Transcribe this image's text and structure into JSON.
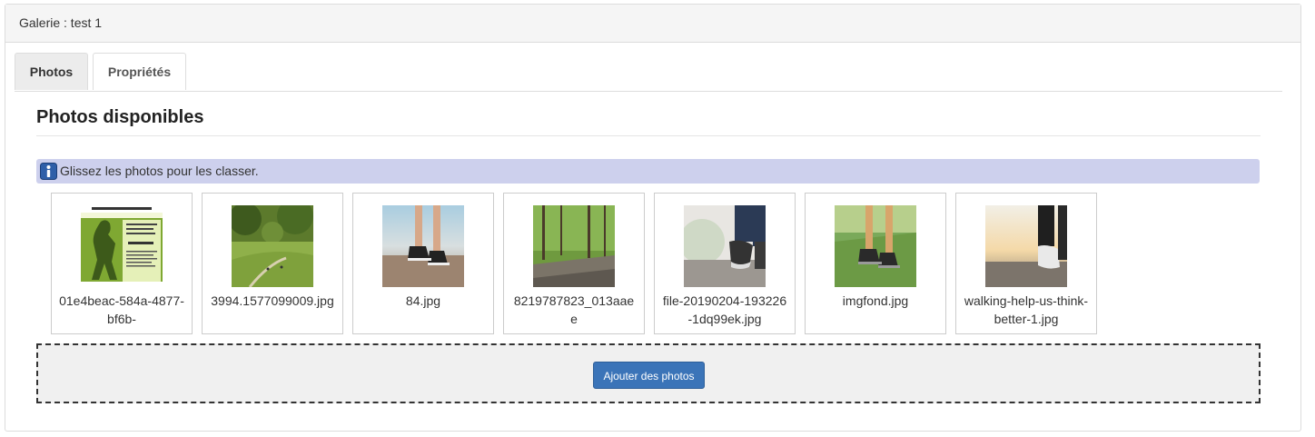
{
  "gallery": {
    "title": "Galerie : test 1"
  },
  "tabs": [
    {
      "label": "Photos",
      "active": true
    },
    {
      "label": "Propriétés",
      "active": false
    }
  ],
  "section": {
    "title": "Photos disponibles"
  },
  "info": {
    "text": "Glissez les photos pour les classer.",
    "icon": "info-icon"
  },
  "photos": [
    {
      "name": "01e4beac-584a-4877-bf6b-",
      "theme": "poster"
    },
    {
      "name": "3994.1577099009.jpg",
      "theme": "park"
    },
    {
      "name": "84.jpg",
      "theme": "road-feet"
    },
    {
      "name": "8219787823_013aaee",
      "theme": "forest-path"
    },
    {
      "name": "file-20190204-193226-1dq99ek.jpg",
      "theme": "walking-feet"
    },
    {
      "name": "imgfond.jpg",
      "theme": "grass-feet"
    },
    {
      "name": "walking-help-us-think-better-1.jpg",
      "theme": "sunset-feet"
    }
  ],
  "upload": {
    "button_label": "Ajouter des photos"
  },
  "colors": {
    "accent": "#3b74b8",
    "info_bg": "#cdd0ed",
    "tab_active_bg": "#ececec"
  }
}
